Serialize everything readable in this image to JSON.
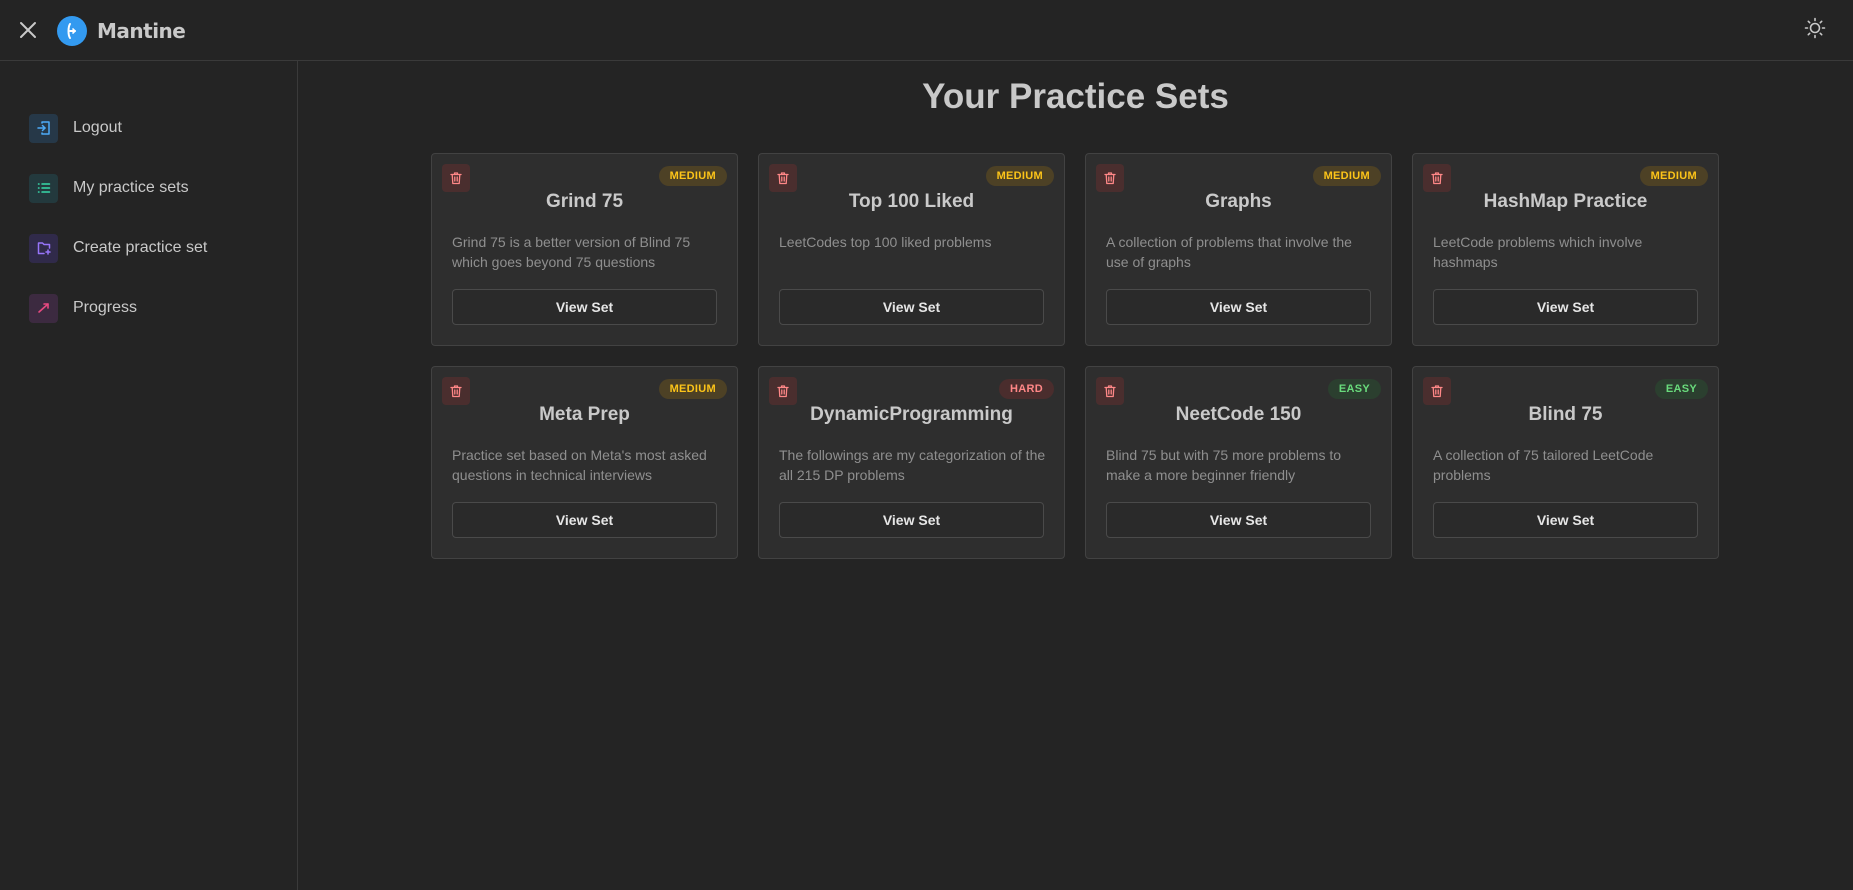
{
  "app": {
    "name": "Mantine"
  },
  "colors": {
    "accent": "#339af0",
    "medium": "#fcc419",
    "hard": "#ff8787",
    "easy": "#69db7c"
  },
  "header": {
    "close_icon": "close-icon",
    "theme_icon": "sun-icon"
  },
  "sidebar": {
    "items": [
      {
        "label": "Logout",
        "icon": "logout-icon"
      },
      {
        "label": "My practice sets",
        "icon": "list-icon"
      },
      {
        "label": "Create practice set",
        "icon": "folder-plus-icon"
      },
      {
        "label": "Progress",
        "icon": "trending-up-icon"
      }
    ]
  },
  "main": {
    "title": "Your Practice Sets",
    "button_label": "View Set",
    "cards": [
      {
        "title": "Grind 75",
        "difficulty": "MEDIUM",
        "description": "Grind 75 is a better version of Blind 75 which goes beyond 75 questions"
      },
      {
        "title": "Top 100 Liked",
        "difficulty": "MEDIUM",
        "description": "LeetCodes top 100 liked problems"
      },
      {
        "title": "Graphs",
        "difficulty": "MEDIUM",
        "description": "A collection of problems that involve the use of graphs"
      },
      {
        "title": "HashMap Practice",
        "difficulty": "MEDIUM",
        "description": "LeetCode problems which involve hashmaps"
      },
      {
        "title": "Meta Prep",
        "difficulty": "MEDIUM",
        "description": "Practice set based on Meta's most asked questions in technical interviews"
      },
      {
        "title": "DynamicProgramming",
        "difficulty": "HARD",
        "description": "The followings are my categorization of the all 215 DP problems"
      },
      {
        "title": "NeetCode 150",
        "difficulty": "EASY",
        "description": "Blind 75 but with 75 more problems to make a more beginner friendly"
      },
      {
        "title": "Blind 75",
        "difficulty": "EASY",
        "description": "A collection of 75 tailored LeetCode problems"
      }
    ]
  }
}
